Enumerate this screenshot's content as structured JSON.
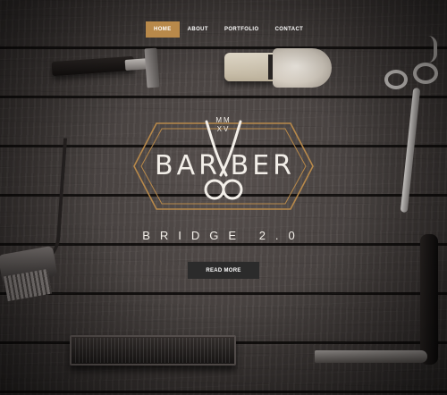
{
  "nav": {
    "items": [
      {
        "label": "HOME",
        "active": true
      },
      {
        "label": "ABOUT",
        "active": false
      },
      {
        "label": "PORTFOLIO",
        "active": false
      },
      {
        "label": "CONTACT",
        "active": false
      }
    ]
  },
  "logo": {
    "left_word": "BAR",
    "right_word": "BER",
    "year_top": "MM",
    "year_bottom": "XV"
  },
  "hero": {
    "tagline": "BRIDGE 2.0",
    "cta_label": "READ MORE"
  },
  "colors": {
    "accent": "#b8894a",
    "cta_background": "#2b2b2b",
    "text": "#f3efe9"
  }
}
